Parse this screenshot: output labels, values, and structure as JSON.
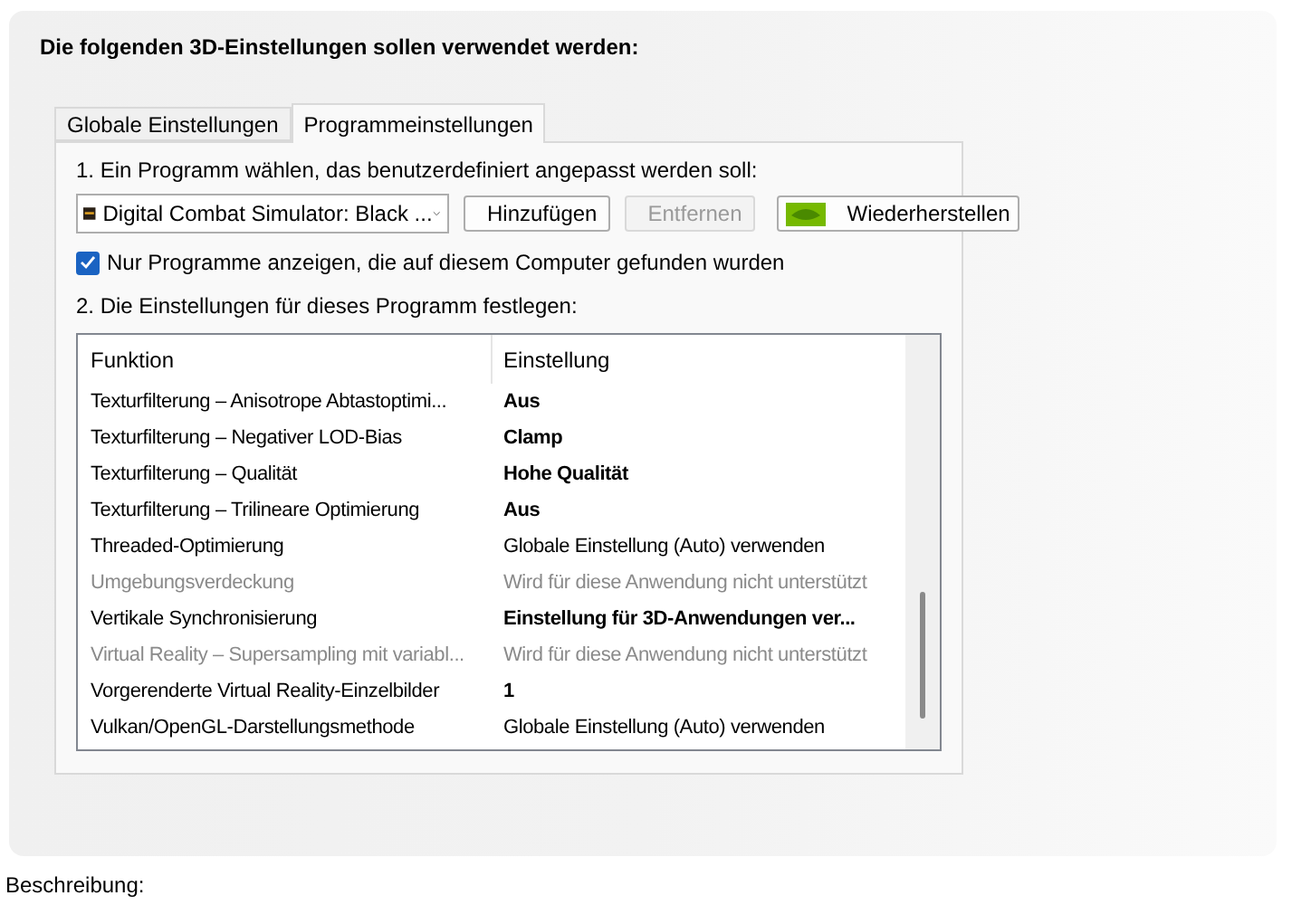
{
  "heading": "Die folgenden 3D-Einstellungen sollen verwendet werden:",
  "tabs": [
    {
      "label": "Globale Einstellungen",
      "selected": false
    },
    {
      "label": "Programmeinstellungen",
      "selected": true
    }
  ],
  "step1": "1. Ein Programm wählen, das benutzerdefiniert angepasst werden soll:",
  "program": {
    "value": "Digital Combat Simulator: Black ..."
  },
  "buttons": [
    {
      "label": "Hinzufügen",
      "disabled": false,
      "kind": "plain"
    },
    {
      "label": "Entfernen",
      "disabled": true,
      "kind": "plain"
    },
    {
      "label": "Wiederherstellen",
      "disabled": false,
      "kind": "restore"
    }
  ],
  "filter": {
    "label": "Nur Programme anzeigen, die auf diesem Computer gefunden wurden",
    "checked": true
  },
  "step2": "2. Die Einstellungen für dieses Programm festlegen:",
  "table": {
    "columns": [
      "Funktion",
      "Einstellung"
    ],
    "rows": [
      {
        "feature": "Texturfilterung – Anisotrope Abtastoptimi...",
        "setting": "Aus",
        "modified": true,
        "disabled": false
      },
      {
        "feature": "Texturfilterung – Negativer LOD-Bias",
        "setting": "Clamp",
        "modified": true,
        "disabled": false
      },
      {
        "feature": "Texturfilterung – Qualität",
        "setting": "Hohe Qualität",
        "modified": true,
        "disabled": false
      },
      {
        "feature": "Texturfilterung – Trilineare Optimierung",
        "setting": "Aus",
        "modified": true,
        "disabled": false
      },
      {
        "feature": "Threaded-Optimierung",
        "setting": "Globale Einstellung (Auto) verwenden",
        "modified": false,
        "disabled": false
      },
      {
        "feature": "Umgebungsverdeckung",
        "setting": "Wird für diese Anwendung nicht unterstützt",
        "modified": false,
        "disabled": true
      },
      {
        "feature": "Vertikale Synchronisierung",
        "setting": "Einstellung für 3D-Anwendungen ver...",
        "modified": true,
        "disabled": false
      },
      {
        "feature": "Virtual Reality – Supersampling mit variabl...",
        "setting": "Wird für diese Anwendung nicht unterstützt",
        "modified": false,
        "disabled": true
      },
      {
        "feature": "Vorgerenderte Virtual Reality-Einzelbilder",
        "setting": "1",
        "modified": true,
        "disabled": false
      },
      {
        "feature": "Vulkan/OpenGL-Darstellungsmethode",
        "setting": "Globale Einstellung (Auto) verwenden",
        "modified": false,
        "disabled": false
      }
    ]
  },
  "description_label": "Beschreibung:"
}
